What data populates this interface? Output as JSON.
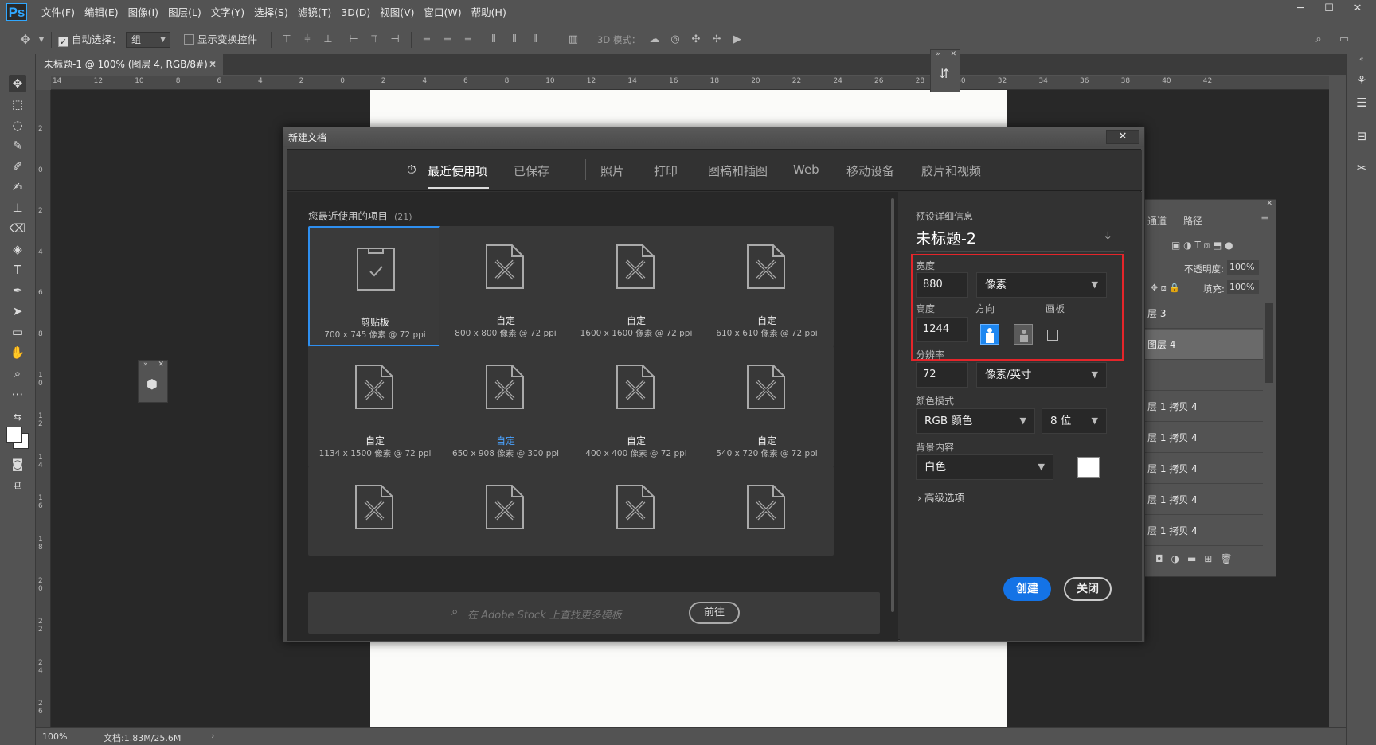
{
  "app": {
    "logo": "Ps",
    "menu": [
      "文件(F)",
      "编辑(E)",
      "图像(I)",
      "图层(L)",
      "文字(Y)",
      "选择(S)",
      "滤镜(T)",
      "3D(D)",
      "视图(V)",
      "窗口(W)",
      "帮助(H)"
    ]
  },
  "options": {
    "auto_select_label": "自动选择：",
    "auto_select_value": "组",
    "show_transform_label": "显示变换控件",
    "mode_3d_label": "3D 模式："
  },
  "document": {
    "tab_title": "未标题-1 @ 100% (图层 4, RGB/8#) *",
    "zoom": "100%",
    "doc_info": "文档:1.83M/25.6M"
  },
  "ruler": {
    "h_ticks": [
      "14",
      "12",
      "10",
      "8",
      "6",
      "4",
      "2",
      "0",
      "2",
      "4",
      "6",
      "8",
      "10",
      "12",
      "14",
      "16",
      "18",
      "20",
      "22",
      "24",
      "26",
      "28",
      "30",
      "32",
      "34",
      "36",
      "38",
      "40",
      "42"
    ],
    "v_ticks": [
      "2",
      "0",
      "2",
      "4",
      "6",
      "8",
      "1 0",
      "1 2",
      "1 4",
      "1 6",
      "1 8",
      "2 0",
      "2 2",
      "2 4",
      "2 6"
    ]
  },
  "layers": {
    "tabs": [
      "通道",
      "路径"
    ],
    "opacity_label": "不透明度:",
    "opacity": "100%",
    "fill_label": "填充:",
    "fill": "100%",
    "rows": [
      "层 3",
      "图层 4",
      "",
      "层 1 拷贝 4",
      "层 1 拷贝 4",
      "层 1 拷贝 4",
      "层 1 拷贝 4",
      "层 1 拷贝 4"
    ]
  },
  "dialog": {
    "title": "新建文档",
    "close_symbol": "✕",
    "tabs": [
      "最近使用项",
      "已保存",
      "照片",
      "打印",
      "图稿和插图",
      "Web",
      "移动设备",
      "胶片和视频"
    ],
    "recent_title": "您最近使用的项目",
    "recent_count": "(21)",
    "presets": [
      {
        "name": "剪贴板",
        "size": "700 x 745 像素 @ 72 ppi"
      },
      {
        "name": "自定",
        "size": "800 x 800 像素 @ 72 ppi"
      },
      {
        "name": "自定",
        "size": "1600 x 1600 像素 @ 72 ppi"
      },
      {
        "name": "自定",
        "size": "610 x 610 像素 @ 72 ppi"
      },
      {
        "name": "自定",
        "size": "1134 x 1500 像素 @ 72 ppi"
      },
      {
        "name": "自定",
        "size": "650 x 908 像素 @ 300 ppi"
      },
      {
        "name": "自定",
        "size": "400 x 400 像素 @ 72 ppi"
      },
      {
        "name": "自定",
        "size": "540 x 720 像素 @ 72 ppi"
      }
    ],
    "stock_placeholder": "在 Adobe Stock 上查找更多模板",
    "stock_button": "前往",
    "details": {
      "header": "预设详细信息",
      "name": "未标题-2",
      "width_label": "宽度",
      "width": "880",
      "width_unit": "像素",
      "height_label": "高度",
      "height": "1244",
      "orientation_label": "方向",
      "artboard_label": "画板",
      "resolution_label": "分辨率",
      "resolution": "72",
      "resolution_unit": "像素/英寸",
      "color_mode_label": "颜色模式",
      "color_mode": "RGB 颜色",
      "bit_depth": "8 位",
      "background_label": "背景内容",
      "background": "白色",
      "advanced": "高级选项",
      "create": "创建",
      "close": "关闭"
    },
    "highlight_color": "#e5252a",
    "accent_color": "#1473e6"
  }
}
